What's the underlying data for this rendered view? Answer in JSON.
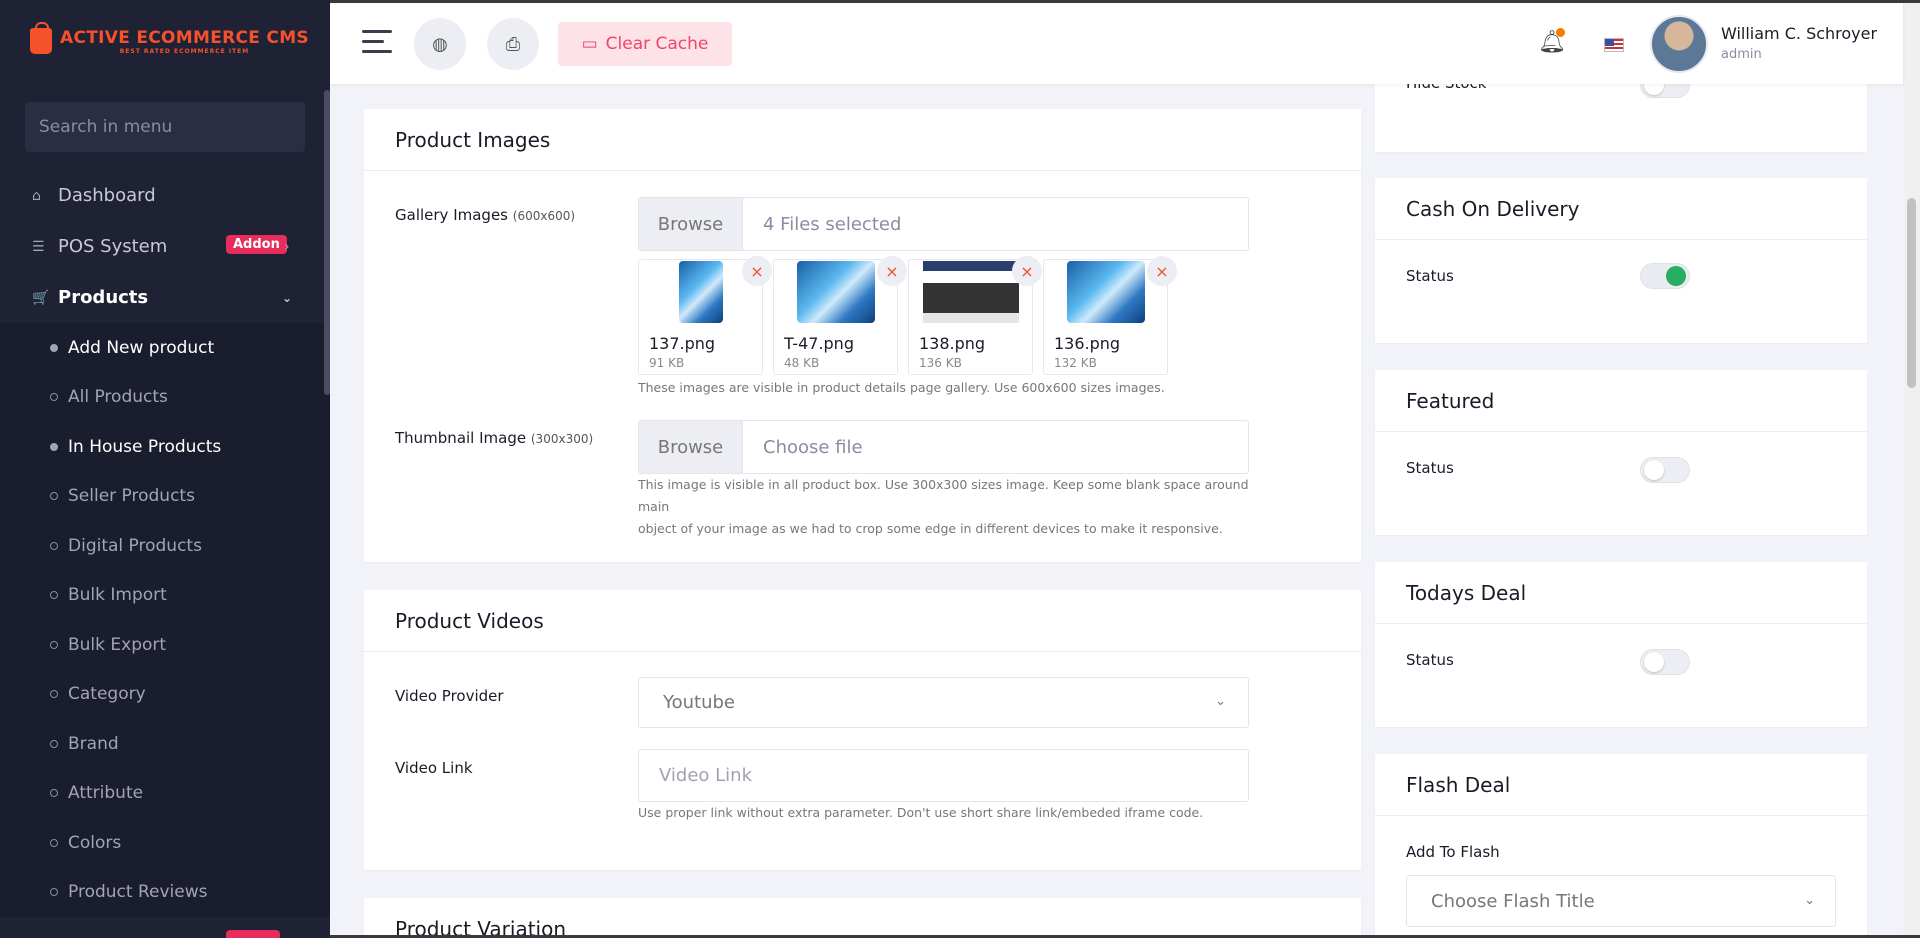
{
  "brand": {
    "title": "ACTIVE ECOMMERCE CMS",
    "subtitle": "BEST RATED ECOMMERCE ITEM"
  },
  "sidebar": {
    "search_placeholder": "Search in menu",
    "items": [
      {
        "label": "Dashboard",
        "icon": "home-icon"
      },
      {
        "label": "POS System",
        "icon": "list-icon",
        "badge": "Addon"
      },
      {
        "label": "Products",
        "icon": "cart-icon"
      }
    ],
    "submenu": [
      {
        "label": "Add New product",
        "active": true
      },
      {
        "label": "All Products"
      },
      {
        "label": "In House Products",
        "active": true
      },
      {
        "label": "Seller Products"
      },
      {
        "label": "Digital Products"
      },
      {
        "label": "Bulk Import"
      },
      {
        "label": "Bulk Export"
      },
      {
        "label": "Category"
      },
      {
        "label": "Brand"
      },
      {
        "label": "Attribute"
      },
      {
        "label": "Colors"
      },
      {
        "label": "Product Reviews"
      }
    ]
  },
  "header": {
    "clear_cache": "Clear Cache",
    "user_name": "William C. Schroyer",
    "user_role": "admin"
  },
  "product_images": {
    "title": "Product Images",
    "gallery_label": "Gallery Images",
    "gallery_size": "(600x600)",
    "browse": "Browse",
    "gallery_status": "4 Files selected",
    "files": [
      {
        "name": "137.png",
        "size": "91 KB"
      },
      {
        "name": "T-47.png",
        "size": "48 KB"
      },
      {
        "name": "138.png",
        "size": "136 KB"
      },
      {
        "name": "136.png",
        "size": "132 KB"
      }
    ],
    "gallery_help": "These images are visible in product details page gallery. Use 600x600 sizes images.",
    "thumb_label": "Thumbnail Image",
    "thumb_size": "(300x300)",
    "thumb_status": "Choose file",
    "thumb_help_1": "This image is visible in all product box. Use 300x300 sizes image. Keep some blank space around main",
    "thumb_help_2": "object of your image as we had to crop some edge in different devices to make it responsive."
  },
  "product_videos": {
    "title": "Product Videos",
    "provider_label": "Video Provider",
    "provider_value": "Youtube",
    "link_label": "Video Link",
    "link_placeholder": "Video Link",
    "link_help": "Use proper link without extra parameter. Don't use short share link/embeded iframe code."
  },
  "product_variation": {
    "title": "Product Variation"
  },
  "right": {
    "hide_stock_label": "Hide Stock",
    "cod": {
      "title": "Cash On Delivery",
      "status_label": "Status",
      "on": true
    },
    "featured": {
      "title": "Featured",
      "status_label": "Status",
      "on": false
    },
    "todays_deal": {
      "title": "Todays Deal",
      "status_label": "Status",
      "on": false
    },
    "flash_deal": {
      "title": "Flash Deal",
      "add_label": "Add To Flash",
      "select_placeholder": "Choose Flash Title"
    }
  },
  "colors": {
    "accent": "#f5512a",
    "sidebar_bg": "#1f2235",
    "badge": "#e72d5c",
    "toggle_on": "#27ae60"
  }
}
